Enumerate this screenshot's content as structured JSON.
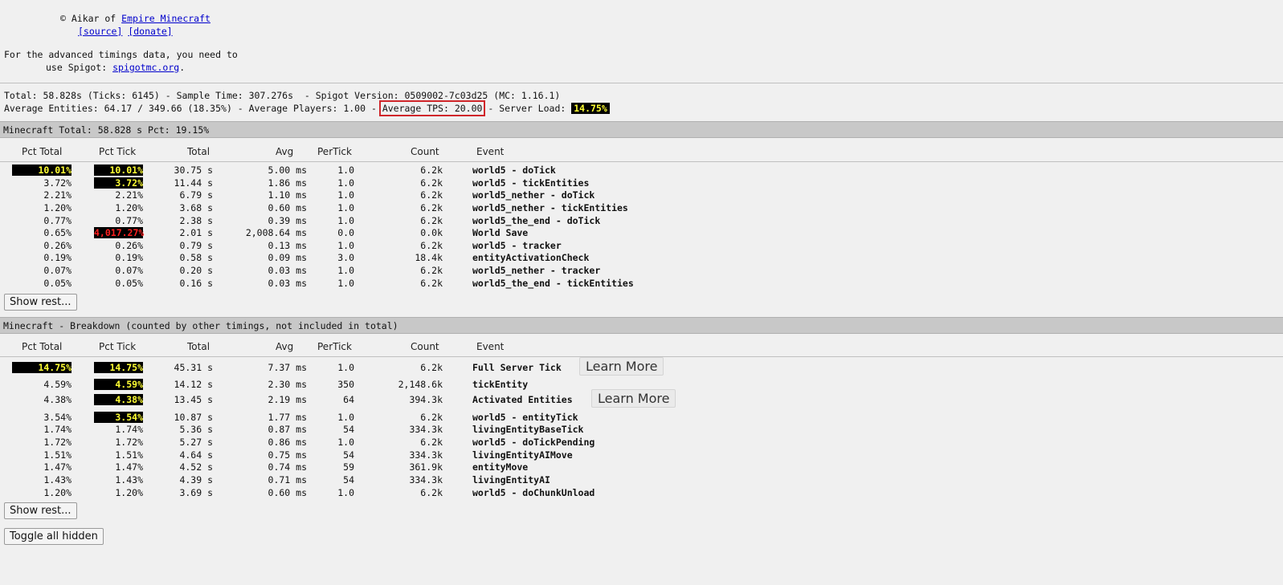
{
  "header": {
    "credit_prefix": "© Aikar of ",
    "credit_link": "Empire Minecraft",
    "source_link": "[source]",
    "donate_link": "[donate]",
    "advanced_line1": "For the advanced timings data, you need to",
    "advanced_line2_prefix": "use Spigot: ",
    "spigot_link": "spigotmc.org",
    "advanced_line2_suffix": "."
  },
  "summary": {
    "line1": "Total: 58.828s (Ticks: 6145) - Sample Time: 307.276s  - Spigot Version: 0509002-7c03d25 (MC: 1.16.1)",
    "line2_prefix": "Average Entities: 64.17 / 349.66 (18.35%) - Average Players: 1.00 - ",
    "tps": "Average TPS: 20.00",
    "line2_mid": " - Server Load: ",
    "server_load": "14.75%"
  },
  "columns": [
    "Pct Total",
    "Pct Tick",
    "Total",
    "Avg",
    "PerTick",
    "Count",
    "Event"
  ],
  "section1": {
    "title": "Minecraft Total: 58.828 s Pct: 19.15%",
    "show_rest": "Show rest...",
    "rows": [
      {
        "pct_total": "10.01%",
        "pct_tick": "10.01%",
        "total": "30.75 s",
        "avg": "5.00 ms",
        "pertick": "1.0",
        "count": "6.2k",
        "event": "world5 - doTick",
        "hl_total": "y",
        "hl_tick": "y"
      },
      {
        "pct_total": "3.72%",
        "pct_tick": "3.72%",
        "total": "11.44 s",
        "avg": "1.86 ms",
        "pertick": "1.0",
        "count": "6.2k",
        "event": "world5 - tickEntities",
        "hl_total": "",
        "hl_tick": "y"
      },
      {
        "pct_total": "2.21%",
        "pct_tick": "2.21%",
        "total": "6.79 s",
        "avg": "1.10 ms",
        "pertick": "1.0",
        "count": "6.2k",
        "event": "world5_nether - doTick",
        "hl_total": "",
        "hl_tick": ""
      },
      {
        "pct_total": "1.20%",
        "pct_tick": "1.20%",
        "total": "3.68 s",
        "avg": "0.60 ms",
        "pertick": "1.0",
        "count": "6.2k",
        "event": "world5_nether - tickEntities",
        "hl_total": "",
        "hl_tick": ""
      },
      {
        "pct_total": "0.77%",
        "pct_tick": "0.77%",
        "total": "2.38 s",
        "avg": "0.39 ms",
        "pertick": "1.0",
        "count": "6.2k",
        "event": "world5_the_end - doTick",
        "hl_total": "",
        "hl_tick": ""
      },
      {
        "pct_total": "0.65%",
        "pct_tick": "4,017.27%",
        "total": "2.01 s",
        "avg": "2,008.64 ms",
        "pertick": "0.0",
        "count": "0.0k",
        "event": "World Save",
        "hl_total": "",
        "hl_tick": "r"
      },
      {
        "pct_total": "0.26%",
        "pct_tick": "0.26%",
        "total": "0.79 s",
        "avg": "0.13 ms",
        "pertick": "1.0",
        "count": "6.2k",
        "event": "world5 - tracker",
        "hl_total": "",
        "hl_tick": ""
      },
      {
        "pct_total": "0.19%",
        "pct_tick": "0.19%",
        "total": "0.58 s",
        "avg": "0.09 ms",
        "pertick": "3.0",
        "count": "18.4k",
        "event": "entityActivationCheck",
        "hl_total": "",
        "hl_tick": ""
      },
      {
        "pct_total": "0.07%",
        "pct_tick": "0.07%",
        "total": "0.20 s",
        "avg": "0.03 ms",
        "pertick": "1.0",
        "count": "6.2k",
        "event": "world5_nether - tracker",
        "hl_total": "",
        "hl_tick": ""
      },
      {
        "pct_total": "0.05%",
        "pct_tick": "0.05%",
        "total": "0.16 s",
        "avg": "0.03 ms",
        "pertick": "1.0",
        "count": "6.2k",
        "event": "world5_the_end - tickEntities",
        "hl_total": "",
        "hl_tick": ""
      }
    ]
  },
  "section2": {
    "title": "Minecraft - Breakdown (counted by other timings, not included in total)",
    "show_rest": "Show rest...",
    "learn_more": "Learn More",
    "rows": [
      {
        "pct_total": "14.75%",
        "pct_tick": "14.75%",
        "total": "45.31 s",
        "avg": "7.37 ms",
        "pertick": "1.0",
        "count": "6.2k",
        "event": "Full Server Tick",
        "hl_total": "y",
        "hl_tick": "y",
        "learn": "y"
      },
      {
        "pct_total": "4.59%",
        "pct_tick": "4.59%",
        "total": "14.12 s",
        "avg": "2.30 ms",
        "pertick": "350",
        "count": "2,148.6k",
        "event": "tickEntity",
        "hl_total": "",
        "hl_tick": "y",
        "learn": ""
      },
      {
        "pct_total": "4.38%",
        "pct_tick": "4.38%",
        "total": "13.45 s",
        "avg": "2.19 ms",
        "pertick": "64",
        "count": "394.3k",
        "event": "Activated Entities",
        "hl_total": "",
        "hl_tick": "y",
        "learn": "y"
      },
      {
        "pct_total": "3.54%",
        "pct_tick": "3.54%",
        "total": "10.87 s",
        "avg": "1.77 ms",
        "pertick": "1.0",
        "count": "6.2k",
        "event": "world5 - entityTick",
        "hl_total": "",
        "hl_tick": "y",
        "learn": ""
      },
      {
        "pct_total": "1.74%",
        "pct_tick": "1.74%",
        "total": "5.36 s",
        "avg": "0.87 ms",
        "pertick": "54",
        "count": "334.3k",
        "event": "livingEntityBaseTick",
        "hl_total": "",
        "hl_tick": "",
        "learn": ""
      },
      {
        "pct_total": "1.72%",
        "pct_tick": "1.72%",
        "total": "5.27 s",
        "avg": "0.86 ms",
        "pertick": "1.0",
        "count": "6.2k",
        "event": "world5 - doTickPending",
        "hl_total": "",
        "hl_tick": "",
        "learn": ""
      },
      {
        "pct_total": "1.51%",
        "pct_tick": "1.51%",
        "total": "4.64 s",
        "avg": "0.75 ms",
        "pertick": "54",
        "count": "334.3k",
        "event": "livingEntityAIMove",
        "hl_total": "",
        "hl_tick": "",
        "learn": ""
      },
      {
        "pct_total": "1.47%",
        "pct_tick": "1.47%",
        "total": "4.52 s",
        "avg": "0.74 ms",
        "pertick": "59",
        "count": "361.9k",
        "event": "entityMove",
        "hl_total": "",
        "hl_tick": "",
        "learn": ""
      },
      {
        "pct_total": "1.43%",
        "pct_tick": "1.43%",
        "total": "4.39 s",
        "avg": "0.71 ms",
        "pertick": "54",
        "count": "334.3k",
        "event": "livingEntityAI",
        "hl_total": "",
        "hl_tick": "",
        "learn": ""
      },
      {
        "pct_total": "1.20%",
        "pct_tick": "1.20%",
        "total": "3.69 s",
        "avg": "0.60 ms",
        "pertick": "1.0",
        "count": "6.2k",
        "event": "world5 - doChunkUnload",
        "hl_total": "",
        "hl_tick": "",
        "learn": ""
      }
    ]
  },
  "toggle_all": "Toggle all hidden"
}
